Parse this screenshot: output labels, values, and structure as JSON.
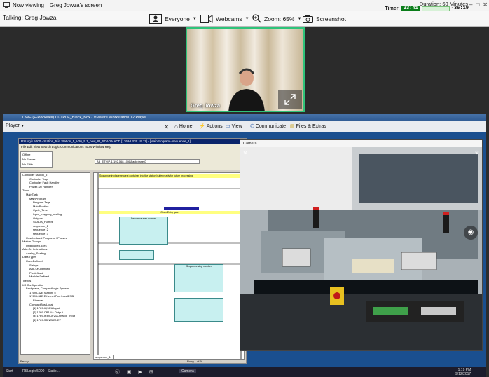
{
  "topbar": {
    "viewing_label": "Now viewing",
    "viewing_name": "Greg Jowza's screen",
    "duration": "Duration: 60 Minutes",
    "timer_label": "Timer:",
    "timer_elapsed": "23:41",
    "timer_remaining": "-36:19"
  },
  "toolbar": {
    "talking": "Talking: Greg Jowza",
    "everyone": "Everyone",
    "webcams": "Webcams",
    "zoom": "Zoom: 65%",
    "screenshot": "Screenshot"
  },
  "webcam": {
    "name": "Greg Jowza"
  },
  "vm": {
    "title": "UWE (F-Rockwell) LT-1PLE_Black_Box - VMware Workstation 12 Player",
    "player_label": "Player",
    "menu": [
      "Home",
      "Actions",
      "View",
      "Communicate",
      "Files & Extras"
    ]
  },
  "rslogix": {
    "title": "RSLogix 5000 - Station_5 in Station_5_V20_5.1_new_IP_SCADA.ACD [1769-L32E 19.11] - [MainProgram - sequence_1]",
    "menu": "File  Edit  View  Search  Logic  Communications  Tools  Window  Help",
    "status_offline": "Offline",
    "status_forces": "No Forces",
    "status_edits": "No Edits",
    "path": "AB_ETHIP-1\\192.168.10.6\\Backplane\\0",
    "tree": [
      "Controller Station_5",
      "Controller Tags",
      "Controller Fault Handler",
      "Power-Up Handler",
      "Tasks",
      "MainTask",
      "MainProgram",
      "Program Tags",
      "MainRoutine",
      "Cycle_Time",
      "Input_mapping_scaling",
      "Outputs",
      "SCADA_Pumps",
      "sequence_1",
      "sequence_2",
      "sequence_3",
      "Unscheduled Programs / Phases",
      "Motion Groups",
      "Ungrouped Axes",
      "Add-On Instructions",
      "Analog_Scaling",
      "Data Types",
      "User-Defined",
      "Strings",
      "Add-On-Defined",
      "Predefined",
      "Module-Defined",
      "Trends",
      "I/O Configuration",
      "Backplane, CompactLogix System",
      "1769-L32E Station_5",
      "1769-L32E Ethernet Port LocalENB",
      "Ethernet",
      "CompactBus Local",
      "[1] 1769-IQ16/A Input",
      "[2] 1769-OB16/A Output",
      "[3] 1769-IF4XOF2/A Analog_Input",
      "[4] 1769-SDN/B DNET"
    ],
    "rung_comment_1": "Sequence in place request container into the station buffer ready for future processing",
    "rung_comment_2": "Open Entry gate",
    "sequence_step": "Sequence step number",
    "status_ready": "Ready",
    "status_rung": "Rung 1 of 9",
    "tab": "sequence_1"
  },
  "camera_window": {
    "title": "Camera"
  },
  "taskbar": {
    "start": "Start",
    "apps": [
      "RSLogix 5000 - Statio...",
      "Camera"
    ],
    "time": "1:19 PM",
    "date": "9/12/2017"
  },
  "colors": {
    "cam_border": "#2fc37a",
    "timer_green": "#0a7d1a"
  }
}
